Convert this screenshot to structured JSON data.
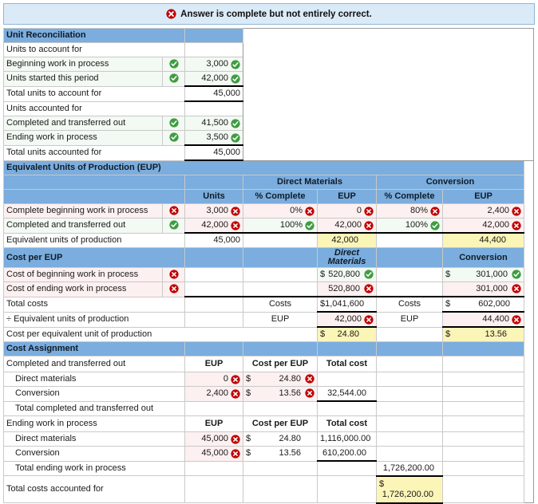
{
  "banner": {
    "icon": "error-circle-icon",
    "text": "Answer is complete but not entirely correct."
  },
  "colors": {
    "header_blue": "#7badde",
    "banner_blue": "#daeaf7",
    "wrong_pink": "#fdf0f0",
    "right_green": "#f3f9f3",
    "highlight_yellow": "#fcf5b8",
    "correct_mark": "#3f9c42",
    "incorrect_mark": "#c00000"
  },
  "unit_reconciliation": {
    "title": "Unit Reconciliation",
    "rows": [
      {
        "label": "Units to account for",
        "mark": "",
        "value": "",
        "value_mark": "",
        "underline": false
      },
      {
        "label": "Beginning work in process",
        "mark": "correct",
        "value": "3,000",
        "value_mark": "correct",
        "underline": false
      },
      {
        "label": "Units started this period",
        "mark": "correct",
        "value": "42,000",
        "value_mark": "correct",
        "underline": true
      },
      {
        "label": "Total units to account for",
        "mark": "",
        "value": "45,000",
        "value_mark": "",
        "underline": false,
        "doubleunder": true
      },
      {
        "label": "Units accounted for",
        "mark": "",
        "value": "",
        "value_mark": "",
        "underline": false
      },
      {
        "label": "Completed and transferred out",
        "mark": "correct",
        "value": "41,500",
        "value_mark": "correct",
        "underline": false
      },
      {
        "label": "Ending work in process",
        "mark": "correct",
        "value": "3,500",
        "value_mark": "correct",
        "underline": true
      },
      {
        "label": "Total units accounted for",
        "mark": "",
        "value": "45,000",
        "value_mark": "",
        "underline": false,
        "doubleunder": true
      }
    ]
  },
  "eup": {
    "title": "Equivalent Units of Production (EUP)",
    "group_headers": {
      "direct_materials": "Direct Materials",
      "conversion": "Conversion"
    },
    "col_headers": {
      "units": "Units",
      "pct_dm": "% Complete",
      "eup_dm": "EUP",
      "pct_cv": "% Complete",
      "eup_cv": "EUP"
    },
    "rows": [
      {
        "label": "Complete beginning work in process",
        "label_mark": "incorrect",
        "units": "3,000",
        "units_mark": "incorrect",
        "pct_dm": "0%",
        "pct_dm_mark": "incorrect",
        "eup_dm": "0",
        "eup_dm_mark": "incorrect",
        "pct_cv": "80%",
        "pct_cv_mark": "incorrect",
        "eup_cv": "2,400",
        "eup_cv_mark": "incorrect"
      },
      {
        "label": "Completed and transferred out",
        "label_mark": "correct",
        "units": "42,000",
        "units_mark": "incorrect",
        "pct_dm": "100%",
        "pct_dm_mark": "correct",
        "eup_dm": "42,000",
        "eup_dm_mark": "incorrect",
        "pct_cv": "100%",
        "pct_cv_mark": "correct",
        "eup_cv": "42,000",
        "eup_cv_mark": "incorrect"
      }
    ],
    "total_row": {
      "label": "Equivalent units of production",
      "units": "45,000",
      "eup_dm": "42,000",
      "eup_cv": "44,400"
    }
  },
  "cost_per_eup": {
    "title": "Cost per EUP",
    "group_headers": {
      "direct_materials": "Direct Materials",
      "conversion": "Conversion"
    },
    "rows": [
      {
        "label": "Cost of beginning work in process",
        "label_mark": "incorrect",
        "dm_dollar": "$",
        "dm_value": "520,800",
        "dm_mark": "correct",
        "cv_dollar": "$",
        "cv_value": "301,000",
        "cv_mark": "correct"
      },
      {
        "label": "Cost of ending work in process",
        "label_mark": "incorrect",
        "dm_dollar": "",
        "dm_value": "520,800",
        "dm_mark": "incorrect",
        "cv_dollar": "",
        "cv_value": "301,000",
        "cv_mark": "incorrect"
      }
    ],
    "total_costs": {
      "label": "Total costs",
      "dm_caption": "Costs",
      "dm_dollar": "$",
      "dm_value": "1,041,600",
      "cv_caption": "Costs",
      "cv_dollar": "$",
      "cv_value": "602,000"
    },
    "divide_eup": {
      "label": "÷ Equivalent units of production",
      "dm_caption": "EUP",
      "dm_value": "42,000",
      "dm_mark": "incorrect",
      "cv_caption": "EUP",
      "cv_value": "44,400",
      "cv_mark": "incorrect"
    },
    "cost_per_unit": {
      "label": "Cost per equivalent unit of production",
      "dm_dollar": "$",
      "dm_value": "24.80",
      "cv_dollar": "$",
      "cv_value": "13.56"
    }
  },
  "cost_assignment": {
    "title": "Cost Assignment",
    "completed": {
      "label": "Completed and transferred out",
      "hdr_eup": "EUP",
      "hdr_cost_per_eup": "Cost per EUP",
      "hdr_total_cost": "Total cost",
      "rows": [
        {
          "label": "Direct materials",
          "eup": "0",
          "eup_mark": "incorrect",
          "dollar": "$",
          "cost": "24.80",
          "cost_mark": "incorrect",
          "total": ""
        },
        {
          "label": "Conversion",
          "eup": "2,400",
          "eup_mark": "incorrect",
          "dollar": "$",
          "cost": "13.56",
          "cost_mark": "incorrect",
          "total": "32,544.00"
        }
      ],
      "total_label": "Total completed and transferred out",
      "total_value": ""
    },
    "ending": {
      "label": "Ending work in process",
      "hdr_eup": "EUP",
      "hdr_cost_per_eup": "Cost per EUP",
      "hdr_total_cost": "Total cost",
      "rows": [
        {
          "label": "Direct materials",
          "eup": "45,000",
          "eup_mark": "incorrect",
          "dollar": "$",
          "cost": "24.80",
          "cost_mark": "",
          "total": "1,116,000.00"
        },
        {
          "label": "Conversion",
          "eup": "45,000",
          "eup_mark": "incorrect",
          "dollar": "$",
          "cost": "13.56",
          "cost_mark": "",
          "total": "610,200.00"
        }
      ],
      "total_label": "Total ending work in process",
      "total_value": "1,726,200.00"
    },
    "grand_total": {
      "label": "Total costs accounted for",
      "dollar": "$",
      "value": "1,726,200.00"
    }
  }
}
